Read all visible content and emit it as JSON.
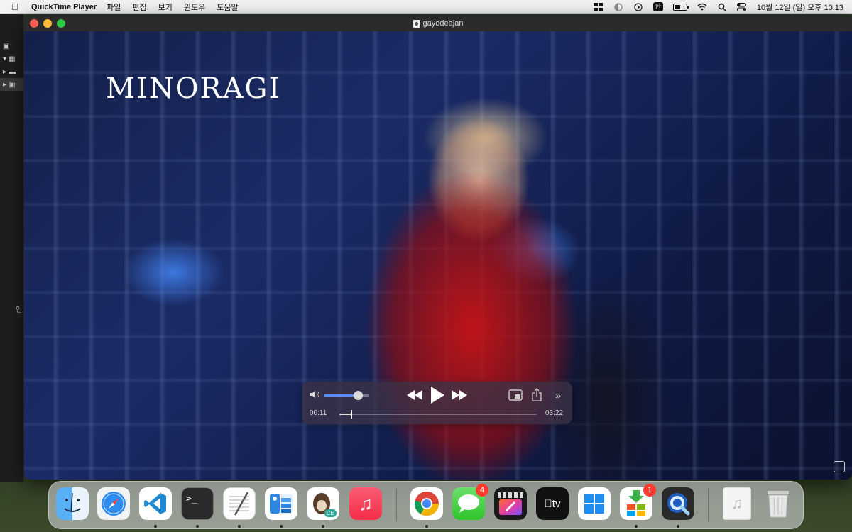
{
  "menubar": {
    "apple_icon": "apple-logo-icon",
    "app_name": "QuickTime Player",
    "menus": [
      "파일",
      "편집",
      "보기",
      "윈도우",
      "도움말"
    ],
    "ime_label": "한",
    "clock": "10월 12일 (일) 오후 10:13"
  },
  "background_panel": {
    "label_fragment": "인"
  },
  "window": {
    "title": "gayodeajan"
  },
  "video": {
    "watermark": "MINORAGI"
  },
  "player": {
    "current_time": "00:11",
    "total_time": "03:22",
    "progress": 0.056,
    "volume": 0.75,
    "colors": {
      "volume_fill": "#5a8dff"
    }
  },
  "dock": {
    "items": [
      {
        "name": "Finder",
        "icon": "finder-icon",
        "running": true
      },
      {
        "name": "Safari",
        "icon": "safari-icon",
        "running": true
      },
      {
        "name": "Visual Studio Code",
        "icon": "vscode-icon",
        "running": true
      },
      {
        "name": "Terminal",
        "icon": "terminal-icon",
        "running": true
      },
      {
        "name": "TextEdit",
        "icon": "textedit-icon",
        "running": true
      },
      {
        "name": "Files",
        "icon": "files-icon",
        "running": true
      },
      {
        "name": "Paw CE",
        "icon": "paw-ce-icon",
        "running": true,
        "label": "CE"
      },
      {
        "name": "Music",
        "icon": "music-icon",
        "running": false
      },
      {
        "name": "Chrome",
        "icon": "chrome-icon",
        "running": true
      },
      {
        "name": "Messages",
        "icon": "messages-icon",
        "running": false,
        "badge": "4"
      },
      {
        "name": "Final Cut Pro",
        "icon": "final-cut-icon",
        "running": false
      },
      {
        "name": "Apple TV",
        "icon": "apple-tv-icon",
        "running": false,
        "label": "tv"
      },
      {
        "name": "Windows App",
        "icon": "windows-app-icon",
        "running": false
      },
      {
        "name": "Microsoft Installer",
        "icon": "ms-installer-icon",
        "running": true,
        "badge": "1"
      },
      {
        "name": "QuickTime Player",
        "icon": "quicktime-icon",
        "running": true
      },
      {
        "name": "Audio File",
        "icon": "audio-file-icon",
        "running": false
      },
      {
        "name": "Trash",
        "icon": "trash-icon",
        "running": false
      }
    ]
  }
}
